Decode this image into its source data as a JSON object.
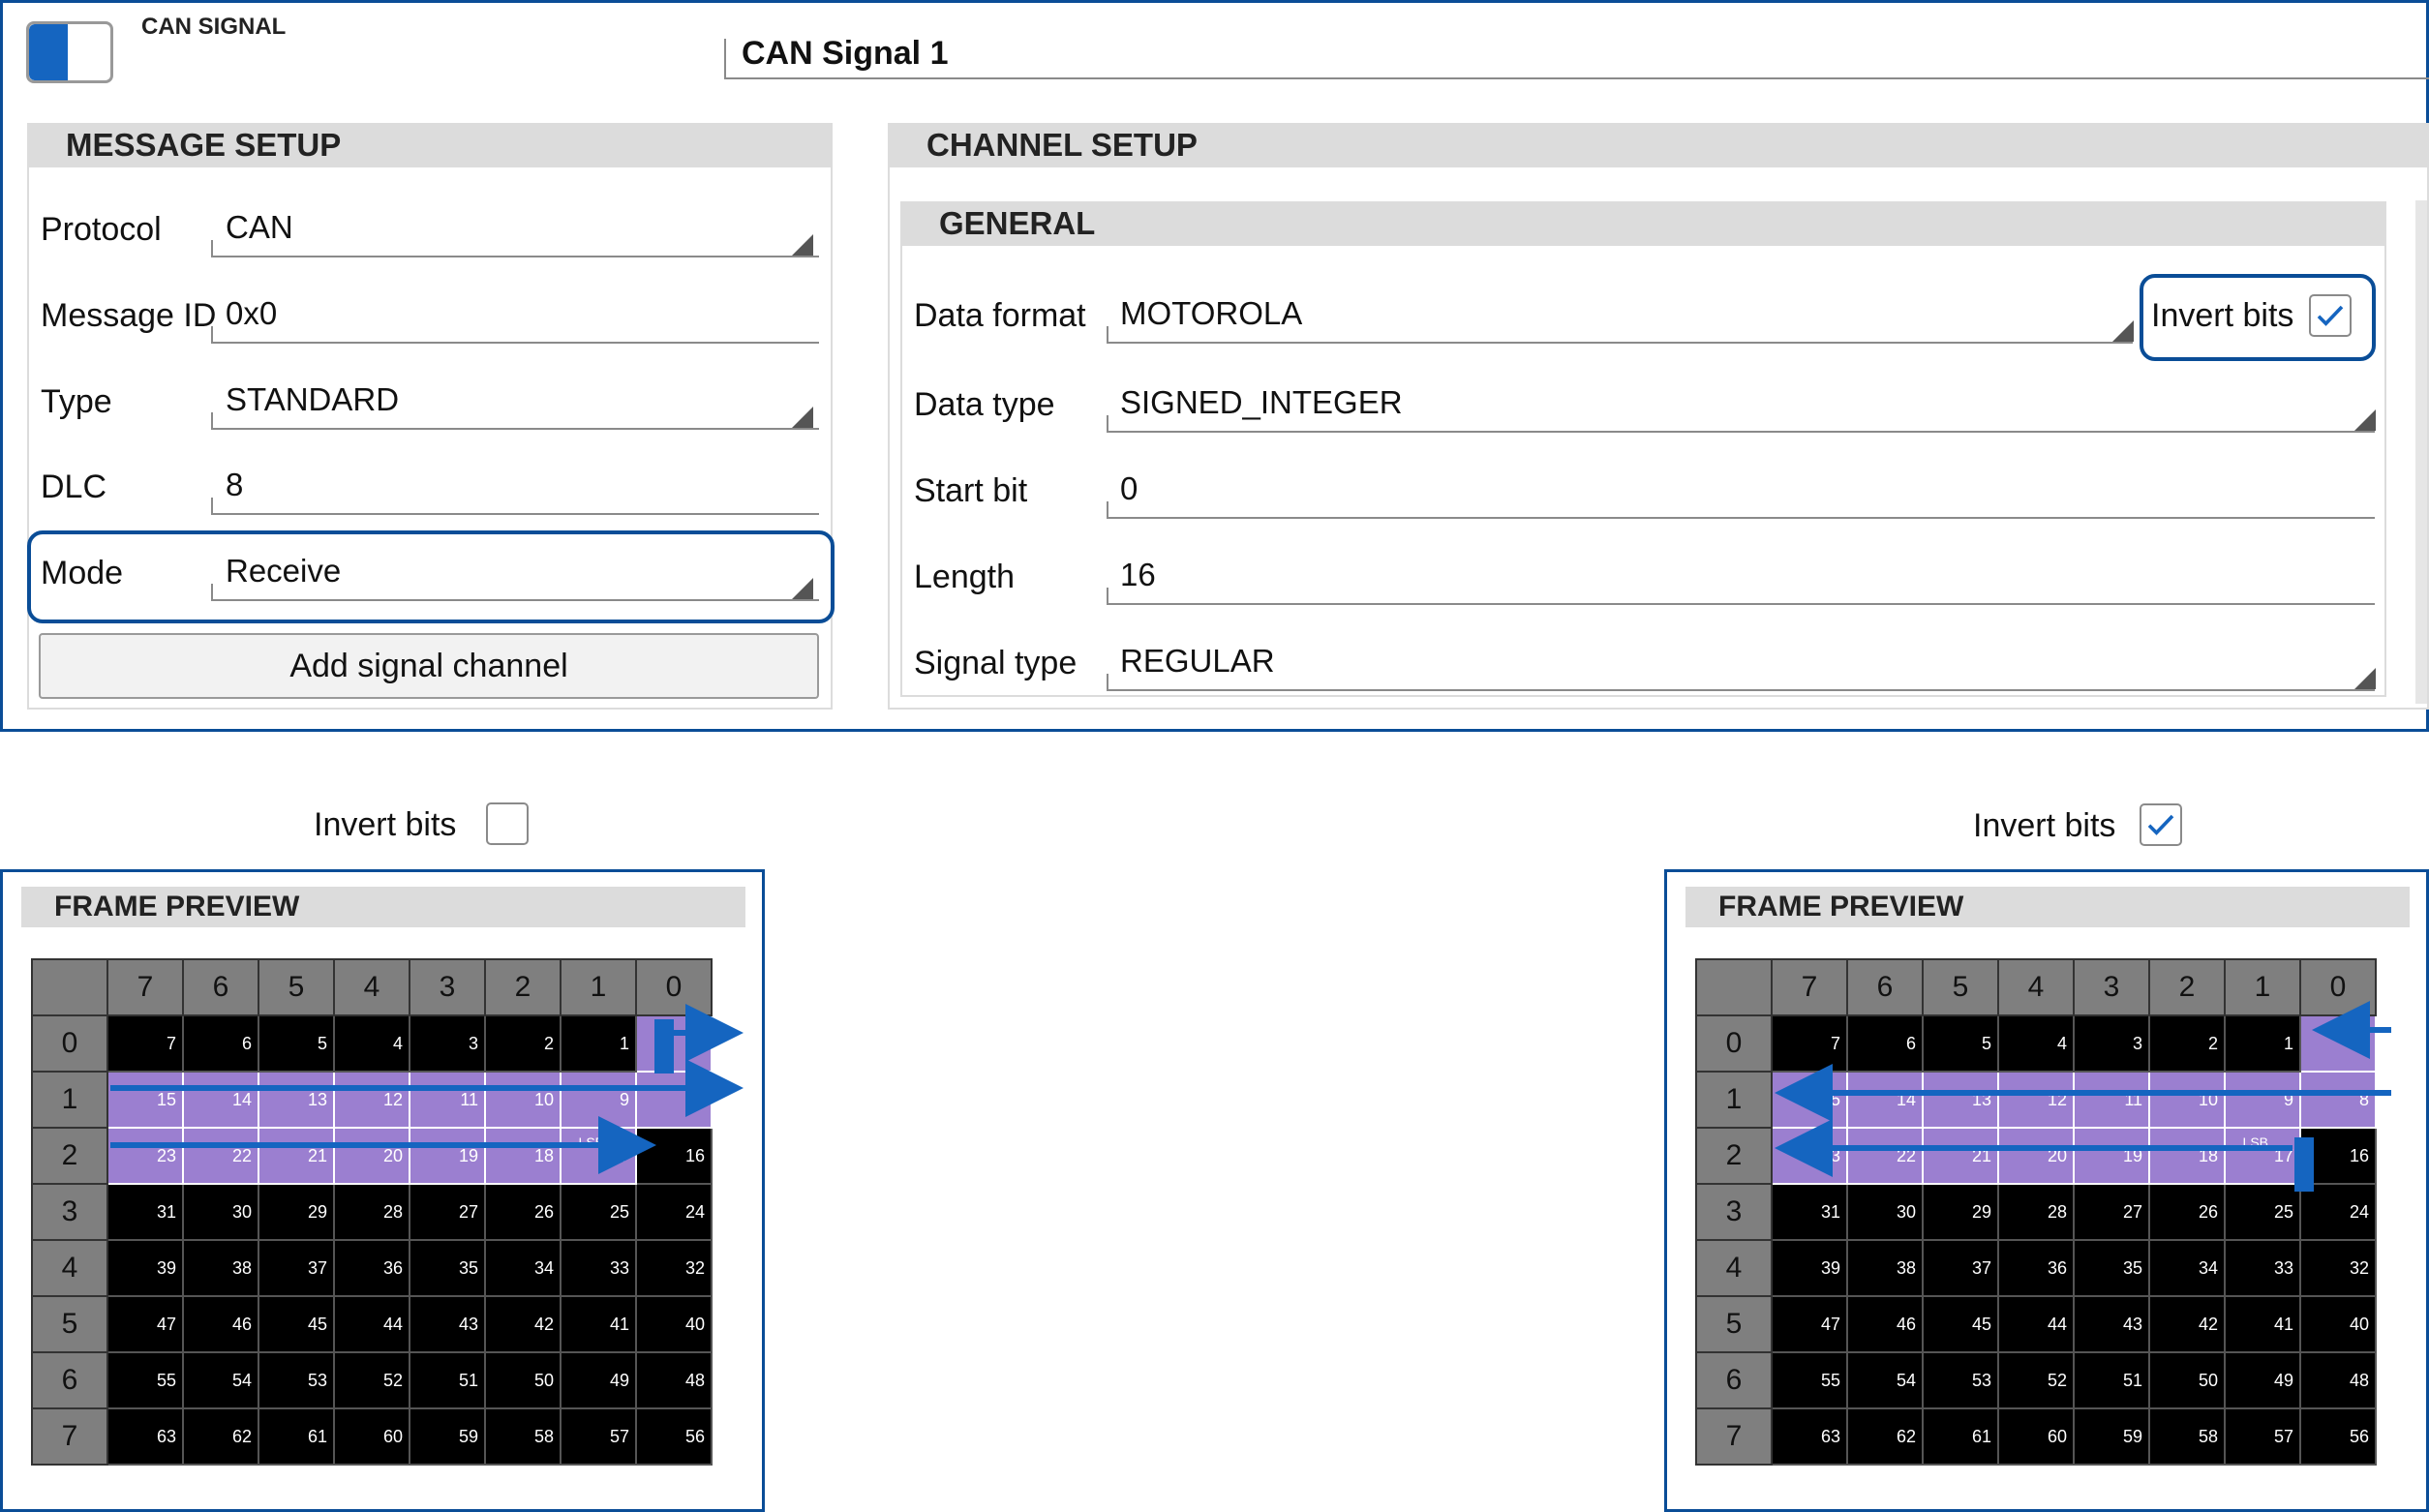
{
  "header": {
    "toggle_label": "CAN SIGNAL",
    "signal_name": "CAN Signal 1"
  },
  "message_setup": {
    "title": "MESSAGE SETUP",
    "fields": [
      {
        "label": "Protocol",
        "value": "CAN",
        "type": "dropdown"
      },
      {
        "label": "Message ID",
        "value": "0x0",
        "type": "input"
      },
      {
        "label": "Type",
        "value": "STANDARD",
        "type": "dropdown"
      },
      {
        "label": "DLC",
        "value": "8",
        "type": "input"
      },
      {
        "label": "Mode",
        "value": "Receive",
        "type": "dropdown"
      }
    ],
    "add_button": "Add signal channel"
  },
  "channel_setup": {
    "title": "CHANNEL SETUP",
    "general_title": "GENERAL",
    "fields": [
      {
        "label": "Data format",
        "value": "MOTOROLA",
        "type": "dropdown"
      },
      {
        "label": "Data type",
        "value": "SIGNED_INTEGER",
        "type": "dropdown"
      },
      {
        "label": "Start bit",
        "value": "0",
        "type": "input"
      },
      {
        "label": "Length",
        "value": "16",
        "type": "input"
      },
      {
        "label": "Signal type",
        "value": "REGULAR",
        "type": "dropdown"
      }
    ],
    "invert_bits_label": "Invert bits",
    "invert_bits_checked": true
  },
  "previews": {
    "left": {
      "invert_label": "Invert bits",
      "invert_checked": false,
      "title": "FRAME PREVIEW"
    },
    "right": {
      "invert_label": "Invert bits",
      "invert_checked": true,
      "title": "FRAME PREVIEW"
    }
  },
  "frame": {
    "column_headers": [
      "7",
      "6",
      "5",
      "4",
      "3",
      "2",
      "1",
      "0"
    ],
    "row_headers": [
      "0",
      "1",
      "2",
      "3",
      "4",
      "5",
      "6",
      "7"
    ],
    "lsb_label": "LSB",
    "selected_bits_left": [
      0,
      8,
      9,
      10,
      11,
      12,
      13,
      14,
      15,
      17,
      18,
      19,
      20,
      21,
      22,
      23
    ],
    "selected_bits_right": [
      0,
      8,
      9,
      10,
      11,
      12,
      13,
      14,
      15,
      17,
      18,
      19,
      20,
      21,
      22,
      23
    ]
  },
  "colors": {
    "frame_blue": "#0a4d97",
    "selected_purple": "#9b7fd0",
    "arrow_blue": "#1565c0"
  }
}
